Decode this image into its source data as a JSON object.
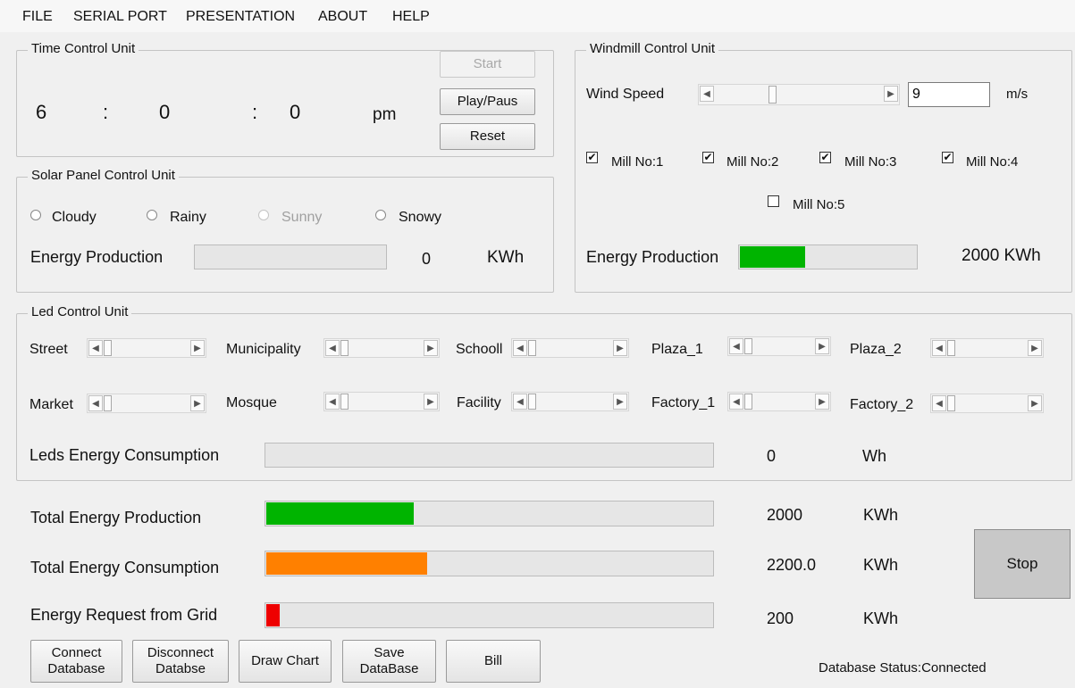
{
  "menu": [
    "FILE",
    "SERIAL PORT",
    "PRESENTATION",
    "ABOUT",
    "HELP"
  ],
  "time_unit": {
    "title": "Time Control Unit",
    "hour": "6",
    "sep1": ":",
    "minute": "0",
    "sep2": ":",
    "second": "0",
    "ampm": "pm",
    "start": "Start",
    "play": "Play/Paus",
    "reset": "Reset"
  },
  "solar_unit": {
    "title": "Solar Panel Control Unit",
    "options": [
      "Cloudy",
      "Rainy",
      "Sunny",
      "Snowy"
    ],
    "disabled_option": "Sunny",
    "energy_label": "Energy Production",
    "energy_value": "0",
    "energy_unit": "KWh",
    "energy_fraction": 0
  },
  "windmill_unit": {
    "title": "Windmill Control Unit",
    "wind_label": "Wind Speed",
    "wind_value": "9",
    "wind_unit": "m/s",
    "mills": [
      {
        "label": "Mill No:1",
        "checked": true
      },
      {
        "label": "Mill No:2",
        "checked": true
      },
      {
        "label": "Mill No:3",
        "checked": true
      },
      {
        "label": "Mill No:4",
        "checked": true
      },
      {
        "label": "Mill No:5",
        "checked": false
      }
    ],
    "energy_label": "Energy Production",
    "energy_value": "2000 KWh",
    "energy_fraction": 0.37
  },
  "led_unit": {
    "title": "Led Control Unit",
    "row1": [
      "Street",
      "Municipality",
      "Schooll",
      "Plaza_1",
      "Plaza_2"
    ],
    "row2": [
      "Market",
      "Mosque",
      "Facility",
      "Factory_1",
      "Factory_2"
    ],
    "consumption_label": "Leds Energy Consumption",
    "consumption_value": "0",
    "consumption_unit": "Wh"
  },
  "totals": {
    "production_label": "Total Energy Production",
    "production_value": "2000",
    "production_unit": "KWh",
    "production_fraction": 0.33,
    "consumption_label": "Total Energy Consumption",
    "consumption_value": "2200.0",
    "consumption_unit": "KWh",
    "consumption_fraction": 0.36,
    "grid_label": "Energy Request from Grid",
    "grid_value": "200",
    "grid_unit": "KWh",
    "grid_fraction": 0.03
  },
  "buttons": {
    "connect": "Connect\nDatabase",
    "disconnect": "Disconnect\nDatabse",
    "draw": "Draw Chart",
    "save": "Save\nDataBase",
    "bill": "Bill",
    "stop": "Stop"
  },
  "status": "Database Status:Connected",
  "colors": {
    "green": "#00b400",
    "orange": "#ff8000",
    "red": "#ee0000"
  }
}
